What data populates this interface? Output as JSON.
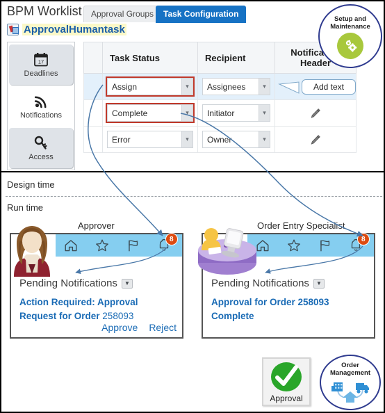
{
  "header": {
    "app_title": "BPM Worklist",
    "tabs": [
      {
        "label": "Approval Groups",
        "active": false
      },
      {
        "label": "Task Configuration",
        "active": true
      }
    ],
    "task_name": "ApprovalHumantask",
    "task_icon": "humantask-icon"
  },
  "setup_badge": {
    "label": "Setup and Maintenance",
    "icon": "gears-icon",
    "ring_color": "#2f3b8f",
    "icon_bg": "#a8c83c"
  },
  "side_tabs": [
    {
      "label": "Deadlines",
      "icon": "calendar-icon",
      "day": "17",
      "active": false
    },
    {
      "label": "Notifications",
      "icon": "rss-icon",
      "active": true
    },
    {
      "label": "Access",
      "icon": "key-icon",
      "active": false
    }
  ],
  "table": {
    "columns": [
      "Task Status",
      "Recipient",
      "Notification Header"
    ],
    "rows": [
      {
        "status": "Assign",
        "recipient": "Assignees",
        "header_icon": "pencil-icon",
        "status_flagged": true,
        "selected": true
      },
      {
        "status": "Complete",
        "recipient": "Initiator",
        "header_icon": "pencil-icon",
        "status_flagged": true,
        "selected": false
      },
      {
        "status": "Error",
        "recipient": "Owner",
        "header_icon": "pencil-icon",
        "status_flagged": false,
        "selected": false
      }
    ],
    "flag_color": "#c0392b",
    "selected_row_color": "#e3f0fb"
  },
  "callout": {
    "text": "Add text"
  },
  "bands": {
    "design_time": "Design time",
    "run_time": "Run time"
  },
  "cards": [
    {
      "role": "Approver",
      "avatar": "woman-avatar",
      "toolbar_icons": [
        "home-icon",
        "star-icon",
        "flag-icon",
        "bell-icon"
      ],
      "badge_count": "8",
      "pending_title": "Pending Notifications",
      "message_bold": "Action Required: Approval Request for Order",
      "message_number": "258093",
      "actions": [
        "Approve",
        "Reject"
      ],
      "toolbar_color": "#85cef0"
    },
    {
      "role": "Order Entry Specialist",
      "avatar": "desk-person-avatar",
      "toolbar_icons": [
        "home-icon",
        "star-icon",
        "flag-icon",
        "bell-icon"
      ],
      "badge_count": "8",
      "pending_title": "Pending Notifications",
      "message_bold": "Approval for Order 258093 Complete",
      "message_number": "",
      "actions": [],
      "toolbar_color": "#85cef0"
    }
  ],
  "bottom": {
    "approval_tile": {
      "label": "Approval",
      "icon": "green-check-icon",
      "icon_color": "#2aa62a"
    },
    "order_management": {
      "label": "Order Management",
      "icon": "supply-chain-icon",
      "ring_color": "#2f3b8f"
    }
  },
  "arrow_color": "#4a78a8"
}
